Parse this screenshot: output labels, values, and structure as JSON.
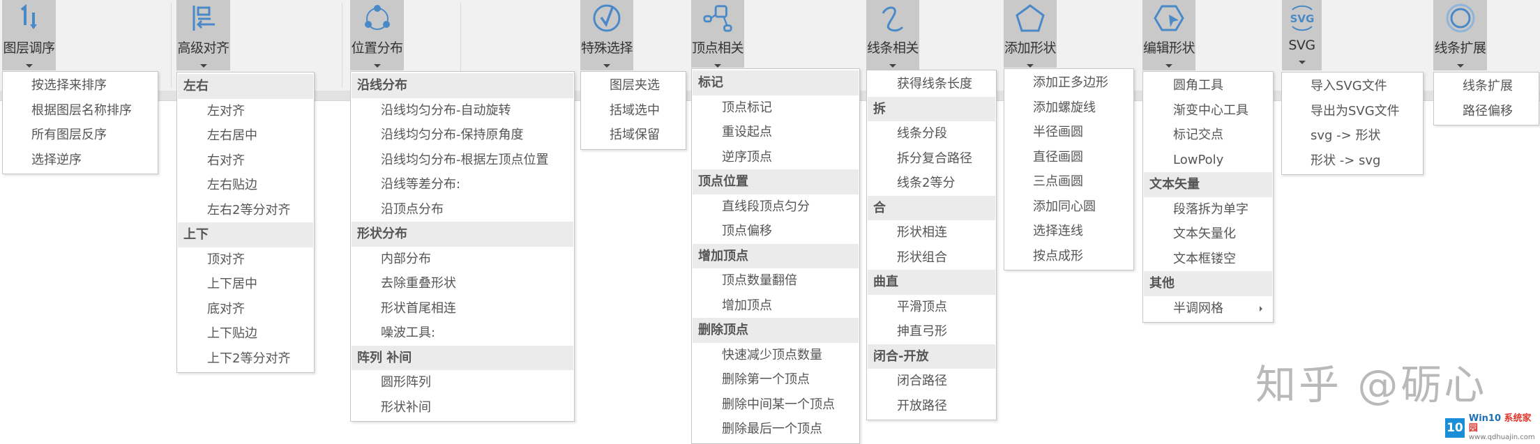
{
  "ribbon": {
    "buttons": [
      {
        "label": "图层调序",
        "icon": "sort-order-icon"
      },
      {
        "label": "高级对齐",
        "icon": "align-left-icon"
      },
      {
        "label": "位置分布",
        "icon": "distribute-circle-icon"
      },
      {
        "label": "特殊选择",
        "icon": "check-circle-icon"
      },
      {
        "label": "顶点相关",
        "icon": "vertex-nodes-icon"
      },
      {
        "label": "线条相关",
        "icon": "curve-line-icon"
      },
      {
        "label": "添加形状",
        "icon": "pentagon-icon"
      },
      {
        "label": "编辑形状",
        "icon": "edit-shape-icon"
      },
      {
        "label": "SVG",
        "icon": "svg-icon"
      },
      {
        "label": "线条扩展",
        "icon": "double-circle-icon"
      }
    ],
    "icon_color": "#4a89c8",
    "svg_icon_text": "SVG"
  },
  "menus": {
    "layer_order": {
      "items": [
        "按选择来排序",
        "根据图层名称排序",
        "所有图层反序",
        "选择逆序"
      ]
    },
    "advanced_align": {
      "sections": [
        {
          "header": "左右",
          "items": [
            "左对齐",
            "左右居中",
            "右对齐",
            "左右贴边",
            "左右2等分对齐"
          ]
        },
        {
          "header": "上下",
          "items": [
            "顶对齐",
            "上下居中",
            "底对齐",
            "上下贴边",
            "上下2等分对齐"
          ]
        }
      ]
    },
    "position_distribution": {
      "sections": [
        {
          "header": "沿线分布",
          "items": [
            "沿线均匀分布-自动旋转",
            "沿线均匀分布-保持原角度",
            "沿线均匀分布-根据左顶点位置",
            "沿线等差分布:",
            "沿顶点分布"
          ]
        },
        {
          "header": "形状分布",
          "items": [
            "内部分布",
            "去除重叠形状",
            "形状首尾相连",
            "噪波工具:"
          ]
        },
        {
          "header": "阵列 补间",
          "items": [
            "圆形阵列",
            "形状补间"
          ]
        }
      ]
    },
    "special_select": {
      "items": [
        "图层夹选",
        "括域选中",
        "括域保留"
      ]
    },
    "vertex": {
      "sections": [
        {
          "header": "标记",
          "items": [
            "顶点标记",
            "重设起点",
            "逆序顶点"
          ]
        },
        {
          "header": "顶点位置",
          "items": [
            "直线段顶点匀分",
            "顶点偏移"
          ]
        },
        {
          "header": "增加顶点",
          "items": [
            "顶点数量翻倍",
            "增加顶点"
          ]
        },
        {
          "header": "删除顶点",
          "items": [
            "快速减少顶点数量",
            "删除第一个顶点",
            "删除中间某一个顶点",
            "删除最后一个顶点"
          ]
        }
      ]
    },
    "line": {
      "top_items": [
        "获得线条长度"
      ],
      "sections": [
        {
          "header": "拆",
          "items": [
            "线条分段",
            "拆分复合路径",
            "线条2等分"
          ]
        },
        {
          "header": "合",
          "items": [
            "形状相连",
            "形状组合"
          ]
        },
        {
          "header": "曲直",
          "items": [
            "平滑顶点",
            "抻直弓形"
          ]
        },
        {
          "header": "闭合-开放",
          "items": [
            "闭合路径",
            "开放路径"
          ]
        }
      ]
    },
    "add_shape": {
      "items": [
        "添加正多边形",
        "添加螺旋线",
        "半径画圆",
        "直径画圆",
        "三点画圆",
        "添加同心圆",
        "选择连线",
        "按点成形"
      ]
    },
    "edit_shape": {
      "top_items": [
        "圆角工具",
        "渐变中心工具",
        "标记交点",
        "LowPoly"
      ],
      "sections": [
        {
          "header": "文本矢量",
          "items": [
            "段落拆为单字",
            "文本矢量化",
            "文本框镂空"
          ]
        },
        {
          "header": "其他",
          "items": [
            "半调网格"
          ]
        }
      ],
      "submenu_item": "半调网格"
    },
    "svg": {
      "items": [
        "导入SVG文件",
        "导出为SVG文件",
        "svg -> 形状",
        "形状 -> svg"
      ]
    },
    "line_extend": {
      "items": [
        "线条扩展",
        "路径偏移"
      ]
    }
  },
  "watermark": {
    "text": "知乎 @砺心",
    "site_logo": "10",
    "site_name_a": "Win10 ",
    "site_name_b": "系统家园",
    "site_url": "www.qdhuajin.com"
  }
}
